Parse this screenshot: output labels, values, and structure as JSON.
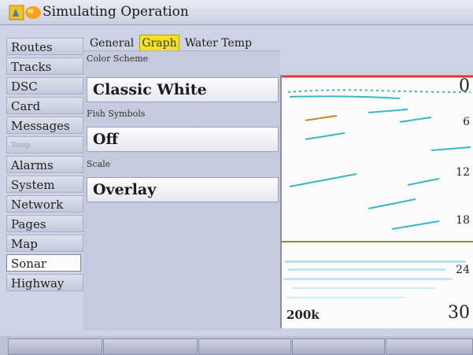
{
  "window": {
    "title": "Simulating Operation",
    "accent_color": "#f4e21a"
  },
  "sidebar": {
    "items": [
      {
        "label": "Routes"
      },
      {
        "label": "Tracks"
      },
      {
        "label": "DSC"
      },
      {
        "label": "Card"
      },
      {
        "label": "Messages"
      },
      {
        "label": "Temp"
      },
      {
        "label": "Alarms"
      },
      {
        "label": "System"
      },
      {
        "label": "Network"
      },
      {
        "label": "Pages"
      },
      {
        "label": "Map"
      },
      {
        "label": "Sonar"
      },
      {
        "label": "Highway"
      }
    ]
  },
  "tabs": [
    {
      "label": "General"
    },
    {
      "label": "Graph"
    },
    {
      "label": "Water Temp"
    }
  ],
  "settings": {
    "color_scheme_label": "Color Scheme",
    "color_scheme_value": "Classic White",
    "fish_symbols_label": "Fish Symbols",
    "fish_symbols_value": "Off",
    "scale_label": "Scale",
    "scale_value": "Overlay"
  },
  "sonar_preview": {
    "depth_scale": [
      "0",
      "6",
      "12",
      "18",
      "24",
      "30"
    ],
    "frequency": "200k"
  },
  "softkeys": [
    "",
    "",
    "",
    "",
    ""
  ]
}
